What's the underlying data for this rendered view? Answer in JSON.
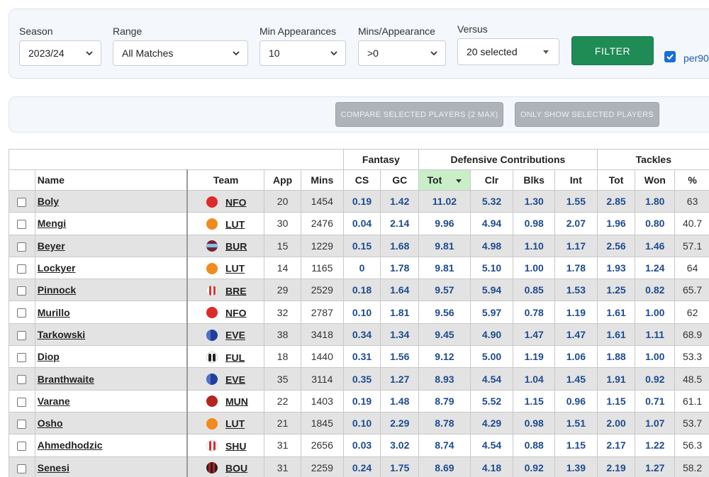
{
  "filters": {
    "season": {
      "label": "Season",
      "value": "2023/24"
    },
    "range": {
      "label": "Range",
      "value": "All Matches"
    },
    "min_appearances": {
      "label": "Min Appearances",
      "value": "10"
    },
    "mins_per_appearance": {
      "label": "Mins/Appearance",
      "value": ">0"
    },
    "versus": {
      "label": "Versus",
      "value": "20 selected"
    },
    "filter_button": "FILTER",
    "per90": {
      "label": "per90",
      "checked": true
    }
  },
  "actions": {
    "compare": "COMPARE SELECTED PLAYERS (2 MAX)",
    "only_show": "ONLY SHOW SELECTED PLAYERS"
  },
  "table": {
    "groups": {
      "fantasy": "Fantasy",
      "defensive": "Defensive Contributions",
      "tackles": "Tackles"
    },
    "headers": {
      "name": "Name",
      "team": "Team",
      "app": "App",
      "mins": "Mins",
      "cs": "CS",
      "gc": "GC",
      "tot": "Tot",
      "clr": "Clr",
      "blks": "Blks",
      "int": "Int",
      "tkl_tot": "Tot",
      "won": "Won",
      "pct": "%"
    },
    "rows": [
      {
        "name": "Boly",
        "team": "NFO",
        "badge": "nfo",
        "app": "20",
        "mins": "1454",
        "cs": "0.19",
        "gc": "1.42",
        "tot": "11.02",
        "clr": "5.32",
        "blks": "1.30",
        "int": "1.55",
        "tkl_tot": "2.85",
        "won": "1.80",
        "pct": "63"
      },
      {
        "name": "Mengi",
        "team": "LUT",
        "badge": "lut",
        "app": "30",
        "mins": "2476",
        "cs": "0.04",
        "gc": "2.14",
        "tot": "9.96",
        "clr": "4.94",
        "blks": "0.98",
        "int": "2.07",
        "tkl_tot": "1.96",
        "won": "0.80",
        "pct": "40.7"
      },
      {
        "name": "Beyer",
        "team": "BUR",
        "badge": "bur",
        "app": "15",
        "mins": "1229",
        "cs": "0.15",
        "gc": "1.68",
        "tot": "9.81",
        "clr": "4.98",
        "blks": "1.10",
        "int": "1.17",
        "tkl_tot": "2.56",
        "won": "1.46",
        "pct": "57.1"
      },
      {
        "name": "Lockyer",
        "team": "LUT",
        "badge": "lut",
        "app": "14",
        "mins": "1165",
        "cs": "0",
        "gc": "1.78",
        "tot": "9.81",
        "clr": "5.10",
        "blks": "1.00",
        "int": "1.78",
        "tkl_tot": "1.93",
        "won": "1.24",
        "pct": "64"
      },
      {
        "name": "Pinnock",
        "team": "BRE",
        "badge": "bre",
        "app": "29",
        "mins": "2529",
        "cs": "0.18",
        "gc": "1.64",
        "tot": "9.57",
        "clr": "5.94",
        "blks": "0.85",
        "int": "1.53",
        "tkl_tot": "1.25",
        "won": "0.82",
        "pct": "65.7"
      },
      {
        "name": "Murillo",
        "team": "NFO",
        "badge": "nfo",
        "app": "32",
        "mins": "2787",
        "cs": "0.10",
        "gc": "1.81",
        "tot": "9.56",
        "clr": "5.97",
        "blks": "0.78",
        "int": "1.19",
        "tkl_tot": "1.61",
        "won": "1.00",
        "pct": "62"
      },
      {
        "name": "Tarkowski",
        "team": "EVE",
        "badge": "eve",
        "app": "38",
        "mins": "3418",
        "cs": "0.34",
        "gc": "1.34",
        "tot": "9.45",
        "clr": "4.90",
        "blks": "1.47",
        "int": "1.47",
        "tkl_tot": "1.61",
        "won": "1.11",
        "pct": "68.9"
      },
      {
        "name": "Diop",
        "team": "FUL",
        "badge": "ful",
        "app": "18",
        "mins": "1440",
        "cs": "0.31",
        "gc": "1.56",
        "tot": "9.12",
        "clr": "5.00",
        "blks": "1.19",
        "int": "1.06",
        "tkl_tot": "1.88",
        "won": "1.00",
        "pct": "53.3"
      },
      {
        "name": "Branthwaite",
        "team": "EVE",
        "badge": "eve",
        "app": "35",
        "mins": "3114",
        "cs": "0.35",
        "gc": "1.27",
        "tot": "8.93",
        "clr": "4.54",
        "blks": "1.04",
        "int": "1.45",
        "tkl_tot": "1.91",
        "won": "0.92",
        "pct": "48.5"
      },
      {
        "name": "Varane",
        "team": "MUN",
        "badge": "mun",
        "app": "22",
        "mins": "1403",
        "cs": "0.19",
        "gc": "1.48",
        "tot": "8.79",
        "clr": "5.52",
        "blks": "1.15",
        "int": "0.96",
        "tkl_tot": "1.15",
        "won": "0.71",
        "pct": "61.1"
      },
      {
        "name": "Osho",
        "team": "LUT",
        "badge": "lut",
        "app": "21",
        "mins": "1845",
        "cs": "0.10",
        "gc": "2.29",
        "tot": "8.78",
        "clr": "4.29",
        "blks": "0.98",
        "int": "1.51",
        "tkl_tot": "2.00",
        "won": "1.07",
        "pct": "53.7"
      },
      {
        "name": "Ahmedhodzic",
        "team": "SHU",
        "badge": "shu",
        "app": "31",
        "mins": "2656",
        "cs": "0.03",
        "gc": "3.02",
        "tot": "8.74",
        "clr": "4.54",
        "blks": "0.88",
        "int": "1.15",
        "tkl_tot": "2.17",
        "won": "1.22",
        "pct": "56.3"
      },
      {
        "name": "Senesi",
        "team": "BOU",
        "badge": "bou",
        "app": "31",
        "mins": "2259",
        "cs": "0.24",
        "gc": "1.75",
        "tot": "8.69",
        "clr": "4.18",
        "blks": "0.92",
        "int": "1.39",
        "tkl_tot": "2.19",
        "won": "1.27",
        "pct": "58.2"
      }
    ]
  },
  "colors": {
    "accent": "#1f8b55",
    "stat_text": "#1e4b8f",
    "sorted_header": "#c9eec8",
    "nfo": "#dd2a2a",
    "lut": "#f28a1e",
    "bur": "#7a2238",
    "bre": "#e03131",
    "eve": "#1f3f9a",
    "ful": "#222222",
    "mun": "#b5251f",
    "shu": "#d92b2b",
    "bou": "#b51f1f"
  }
}
